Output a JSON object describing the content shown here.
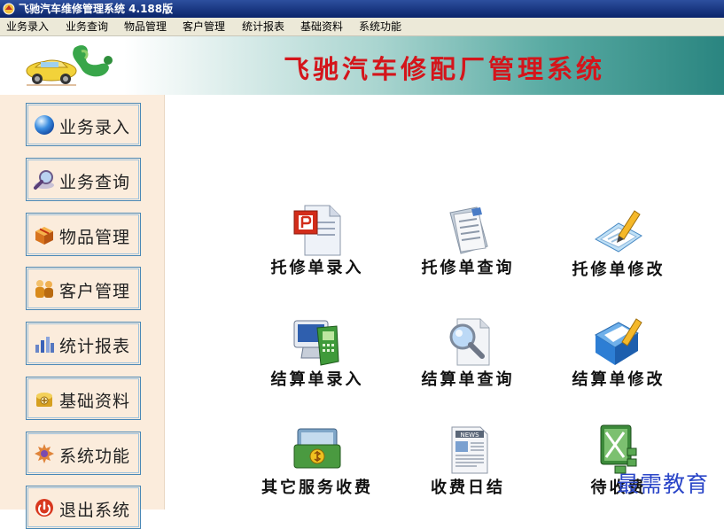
{
  "window": {
    "title": "飞驰汽车维修管理系统 4.188版"
  },
  "menu": [
    {
      "label": "业务录入"
    },
    {
      "label": "业务查询"
    },
    {
      "label": "物品管理"
    },
    {
      "label": "客户管理"
    },
    {
      "label": "统计报表"
    },
    {
      "label": "基础资料"
    },
    {
      "label": "系统功能"
    }
  ],
  "banner": {
    "title": "飞驰汽车修配厂管理系统"
  },
  "sidebar": [
    {
      "label": "业务录入",
      "icon": "globe-icon"
    },
    {
      "label": "业务查询",
      "icon": "magnifier-icon"
    },
    {
      "label": "物品管理",
      "icon": "box-icon"
    },
    {
      "label": "客户管理",
      "icon": "people-icon"
    },
    {
      "label": "统计报表",
      "icon": "bar-chart-icon"
    },
    {
      "label": "基础资料",
      "icon": "database-icon"
    },
    {
      "label": "系统功能",
      "icon": "gear-icon"
    },
    {
      "label": "退出系统",
      "icon": "exit-icon"
    }
  ],
  "tiles": [
    {
      "label": "托修单录入",
      "icon": "document-entry-icon"
    },
    {
      "label": "托修单查询",
      "icon": "document-list-icon"
    },
    {
      "label": "托修单修改",
      "icon": "document-edit-icon"
    },
    {
      "label": "结算单录入",
      "icon": "terminal-entry-icon"
    },
    {
      "label": "结算单查询",
      "icon": "document-search-icon"
    },
    {
      "label": "结算单修改",
      "icon": "folder-edit-icon"
    },
    {
      "label": "其它服务收费",
      "icon": "money-icon"
    },
    {
      "label": "收费日结",
      "icon": "daily-report-icon"
    },
    {
      "label": "待收费",
      "icon": "spreadsheet-icon"
    }
  ],
  "watermark": {
    "text": "最需教育"
  }
}
